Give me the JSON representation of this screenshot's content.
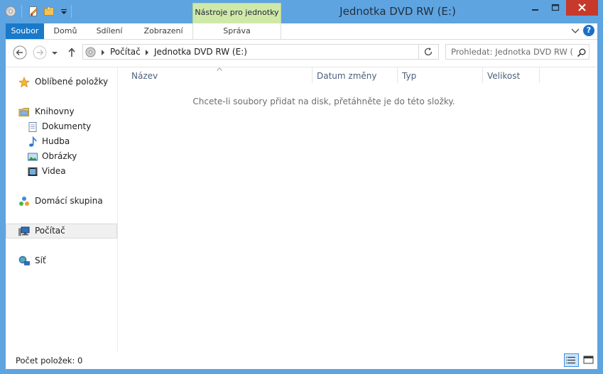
{
  "window": {
    "title": "Jednotka DVD RW (E:)",
    "context_tab_group": "Nástroje pro jednotky"
  },
  "ribbon": {
    "tabs": [
      {
        "id": "file",
        "label": "Soubor",
        "active": true
      },
      {
        "id": "home",
        "label": "Domů"
      },
      {
        "id": "share",
        "label": "Sdílení"
      },
      {
        "id": "view",
        "label": "Zobrazení"
      },
      {
        "id": "manage",
        "label": "Správa"
      }
    ]
  },
  "address": {
    "breadcrumbs": [
      "Počítač",
      "Jednotka DVD RW (E:)"
    ]
  },
  "search": {
    "placeholder": "Prohledat: Jednotka DVD RW (..."
  },
  "nav_pane": {
    "favorites": "Oblíbené položky",
    "libraries": "Knihovny",
    "library_items": [
      "Dokumenty",
      "Hudba",
      "Obrázky",
      "Videa"
    ],
    "homegroup": "Domácí skupina",
    "computer": "Počítač",
    "network": "Síť"
  },
  "columns": [
    "Název",
    "Datum změny",
    "Typ",
    "Velikost"
  ],
  "empty_message": "Chcete-li soubory přidat na disk, přetáhněte je do této složky.",
  "status": {
    "item_count": "Počet položek: 0"
  },
  "colors": {
    "frame": "#5ea4e1",
    "file_tab": "#1979ca",
    "context_tab": "#cfe9a9",
    "close_button": "#c7392b"
  }
}
